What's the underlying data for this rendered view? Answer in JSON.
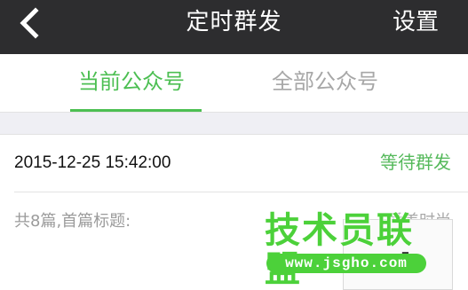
{
  "navbar": {
    "back_icon": "chevron-left-icon",
    "title": "定时群发",
    "settings_label": "设置",
    "background_color": "#2d2d2f"
  },
  "tabs": [
    {
      "label": "当前公众号",
      "active": true
    },
    {
      "label": "全部公众号",
      "active": false
    }
  ],
  "accent_color": "#4cbf52",
  "scheduled_item": {
    "datetime": "2015-12-25 15:42:00",
    "status": "等待群发",
    "summary": "共8篇,首篇标题:",
    "first_title": "爱美时尚"
  },
  "watermark": {
    "text": "技术员联盟",
    "url": "www.jsgho.com"
  }
}
